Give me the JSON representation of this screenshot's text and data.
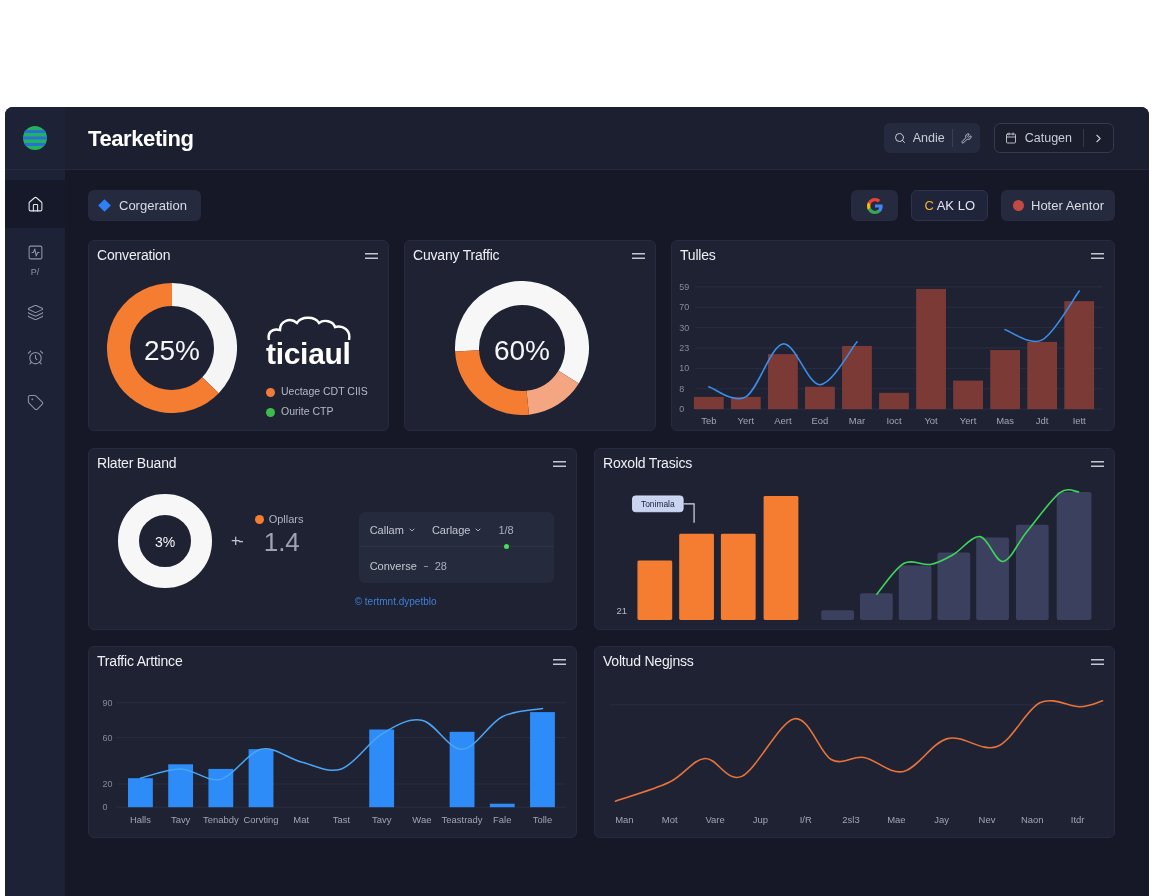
{
  "sidebar": {
    "items": [
      {
        "selected": true
      },
      {
        "label": "P/",
        "selected": false
      },
      {
        "selected": false
      },
      {
        "selected": false
      },
      {
        "selected": false
      }
    ]
  },
  "header": {
    "title": "Tearketing",
    "search_button": {
      "label": "Andie"
    },
    "category_button": {
      "label": "Catugen"
    }
  },
  "toolbar": {
    "filter_chip": {
      "label": "Corgeration"
    },
    "chips": [
      {
        "kind": "logo"
      },
      {
        "kind": "code",
        "accent": "C",
        "label": "AK LO"
      },
      {
        "kind": "status",
        "label": "Hoter Aentor"
      }
    ]
  },
  "conversion_card": {
    "title": "Converation",
    "center_label": "25%",
    "logo_text": "ticiaul",
    "legend": [
      {
        "label": "Uectage CDT CIIS",
        "color": "#f07b3a"
      },
      {
        "label": "Ourite CTP",
        "color": "#3dbb4c"
      }
    ]
  },
  "traffic_card": {
    "title": "Cuvany Traffic",
    "center_label": "60%"
  },
  "tulles_card": {
    "title": "Tulles",
    "y_labels": [
      "59",
      "70",
      "30",
      "23",
      "10",
      "8",
      "0"
    ],
    "x_labels": [
      "Teb",
      "Yert",
      "Aert",
      "Eod",
      "Mar",
      "Ioct",
      "Yot",
      "Yert",
      "Mas",
      "Jdt",
      "Iett"
    ]
  },
  "buand_card": {
    "title": "Rlater Buand",
    "ring_label": "3%",
    "sign": "+-",
    "legend_label": "Opllars",
    "metric": "1.4",
    "filters": [
      {
        "label": "Callam"
      },
      {
        "label": "Carlage"
      }
    ],
    "ratio": "1/8",
    "summary_label": "Converse",
    "summary_value": "28",
    "link": "© tertmnt.dypetblo"
  },
  "trasics_card": {
    "title": "Roxold Trasics",
    "callout": "Tonimala",
    "axis_label": "21"
  },
  "arttince_card": {
    "title": "Traffic Arttince",
    "chart_data": {
      "type": "bar",
      "grid": true,
      "categories": [
        "Halls",
        "Tavy",
        "Tenabdy",
        "Corvting",
        "Mat",
        "Tast",
        "Tavy",
        "Wae",
        "Teastrady",
        "Fale",
        "Tolle"
      ],
      "series": [
        {
          "type": "bar",
          "color": "#2d8cf7",
          "values": [
            25,
            37,
            33,
            50,
            null,
            null,
            67,
            null,
            65,
            3,
            82
          ]
        },
        {
          "type": "line",
          "color": "#4aa6f5",
          "values": [
            25,
            33,
            24,
            50,
            39,
            33,
            63,
            75,
            50,
            78,
            85
          ]
        }
      ],
      "ylim": [
        0,
        90
      ],
      "yticks": [
        0,
        20,
        60,
        90
      ]
    }
  },
  "negjnss_card": {
    "title": "Voltud Negjnss",
    "x_labels": [
      "Man",
      "Mot",
      "Vare",
      "Jup",
      "I/R",
      "2sl3",
      "Mae",
      "Jay",
      "Nev",
      "Naon",
      "Itdr"
    ]
  }
}
